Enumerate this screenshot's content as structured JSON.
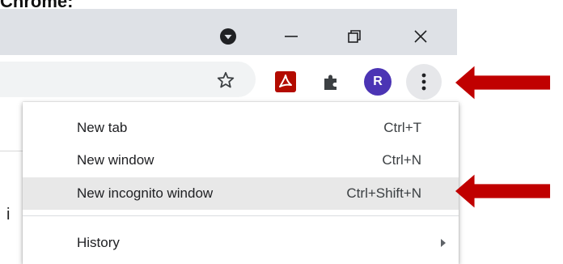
{
  "top_text": "Chrome:",
  "window_controls": {
    "media_icon": "media-control-icon",
    "minimize_icon": "minimize-icon",
    "restore_icon": "restore-icon",
    "close_icon": "close-icon"
  },
  "toolbar": {
    "bookmark_icon": "star-icon",
    "pdf_extension_icon": "acrobat-icon",
    "extensions_icon": "puzzle-icon",
    "profile_initial": "R",
    "menu_icon": "three-dots-icon"
  },
  "menu": {
    "items": [
      {
        "label": "New tab",
        "shortcut": "Ctrl+T"
      },
      {
        "label": "New window",
        "shortcut": "Ctrl+N"
      },
      {
        "label": "New incognito window",
        "shortcut": "Ctrl+Shift+N"
      },
      {
        "label": "History",
        "shortcut": ""
      }
    ]
  },
  "page": {
    "partial_text": "i"
  },
  "colors": {
    "arrow": "#c00000",
    "avatar": "#4b34b4",
    "titlebar": "#dee1e6",
    "highlight": "#e8e8e8"
  }
}
